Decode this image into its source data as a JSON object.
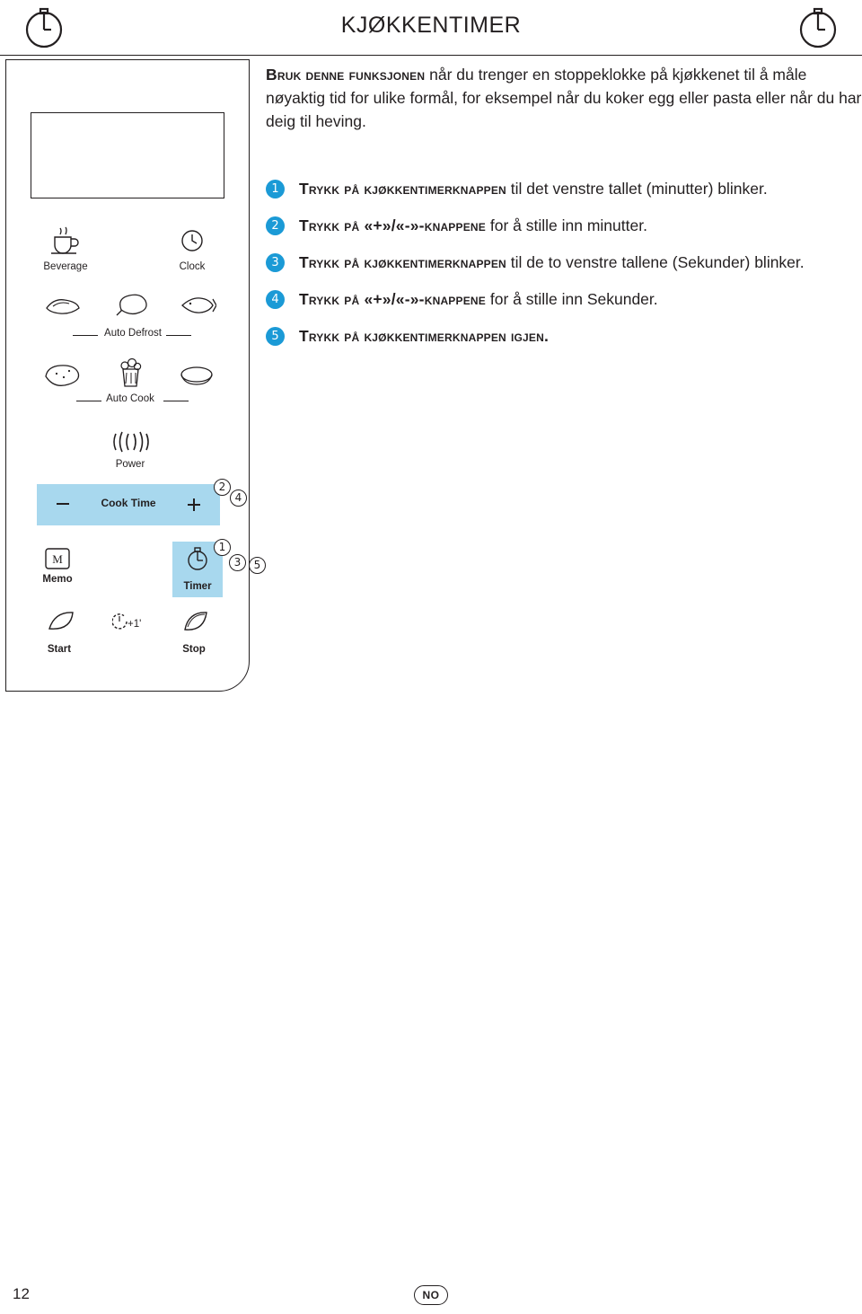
{
  "header": {
    "title": "KJØKKENTIMER",
    "left_icon": "stopwatch-icon",
    "right_icon": "stopwatch-icon"
  },
  "intro": {
    "lead": "Bruk denne funksjonen",
    "body": " når du trenger en stoppeklokke på kjøkkenet til å måle nøyaktig tid for ulike formål, for eksempel når du koker egg eller pasta eller når du har deig til heving."
  },
  "steps": [
    {
      "num": "1",
      "lead": "Trykk på kjøkkentimerknappen",
      "rest": " til det venstre tallet (minutter) blinker."
    },
    {
      "num": "2",
      "lead": "Trykk på «+»/«-»-knappene",
      "rest": " for å stille inn minutter."
    },
    {
      "num": "3",
      "lead": "Trykk på kjøkkentimerknappen",
      "rest": " til de to venstre tallene (Sekunder) blinker."
    },
    {
      "num": "4",
      "lead": "Trykk på «+»/«-»-knappene",
      "rest": " for å stille inn Sekunder."
    },
    {
      "num": "5",
      "lead": "Trykk på kjøkkentimerknappen igjen.",
      "rest": ""
    }
  ],
  "panel": {
    "beverage_label": "Beverage",
    "clock_label": "Clock",
    "auto_defrost_label": "Auto Defrost",
    "auto_cook_label": "Auto Cook",
    "power_label": "Power",
    "cook_time_label": "Cook Time",
    "memo_label": "Memo",
    "timer_label": "Timer",
    "start_label": "Start",
    "stop_label": "Stop",
    "plus_one_label": "+1'",
    "memo_glyph": "M",
    "callouts": [
      {
        "num": "2"
      },
      {
        "num": "4"
      },
      {
        "num": "1"
      },
      {
        "num": "3"
      },
      {
        "num": "5"
      }
    ]
  },
  "footer": {
    "page_number": "12",
    "language": "NO"
  },
  "colors": {
    "accent_blue": "#1b9ad6",
    "panel_highlight": "#a8d8ee",
    "ink": "#231f20"
  }
}
